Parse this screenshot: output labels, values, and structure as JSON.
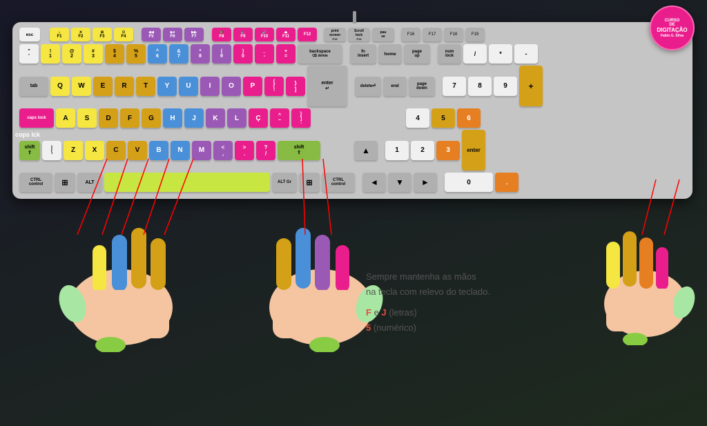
{
  "badge": {
    "line1": "CURSO",
    "line2": "DE",
    "line3": "DIGITAÇÃO"
  },
  "keyboard": {
    "rows": [
      {
        "id": "fn",
        "keys": [
          "esc",
          "F1",
          "F2",
          "F3",
          "F4",
          "F5",
          "F6",
          "F7",
          "F8",
          "F9",
          "F10",
          "F11",
          "F12",
          "print\nscreen",
          "Scroll\nlock",
          "pau\nse",
          "F16",
          "F17",
          "F18",
          "F19"
        ]
      }
    ]
  },
  "text": {
    "line1": "Sempre mantenha as mãos",
    "line2": "na tecla com relevo do teclado.",
    "line3": "F e J (letras)",
    "line4": "5 (numérico)",
    "f_label": "F",
    "e_label": " e ",
    "j_label": "J",
    "letras_label": " (letras)",
    "num_label": "5",
    "numerico_label": " (numérico)"
  },
  "caps_lock": "cops Ick"
}
